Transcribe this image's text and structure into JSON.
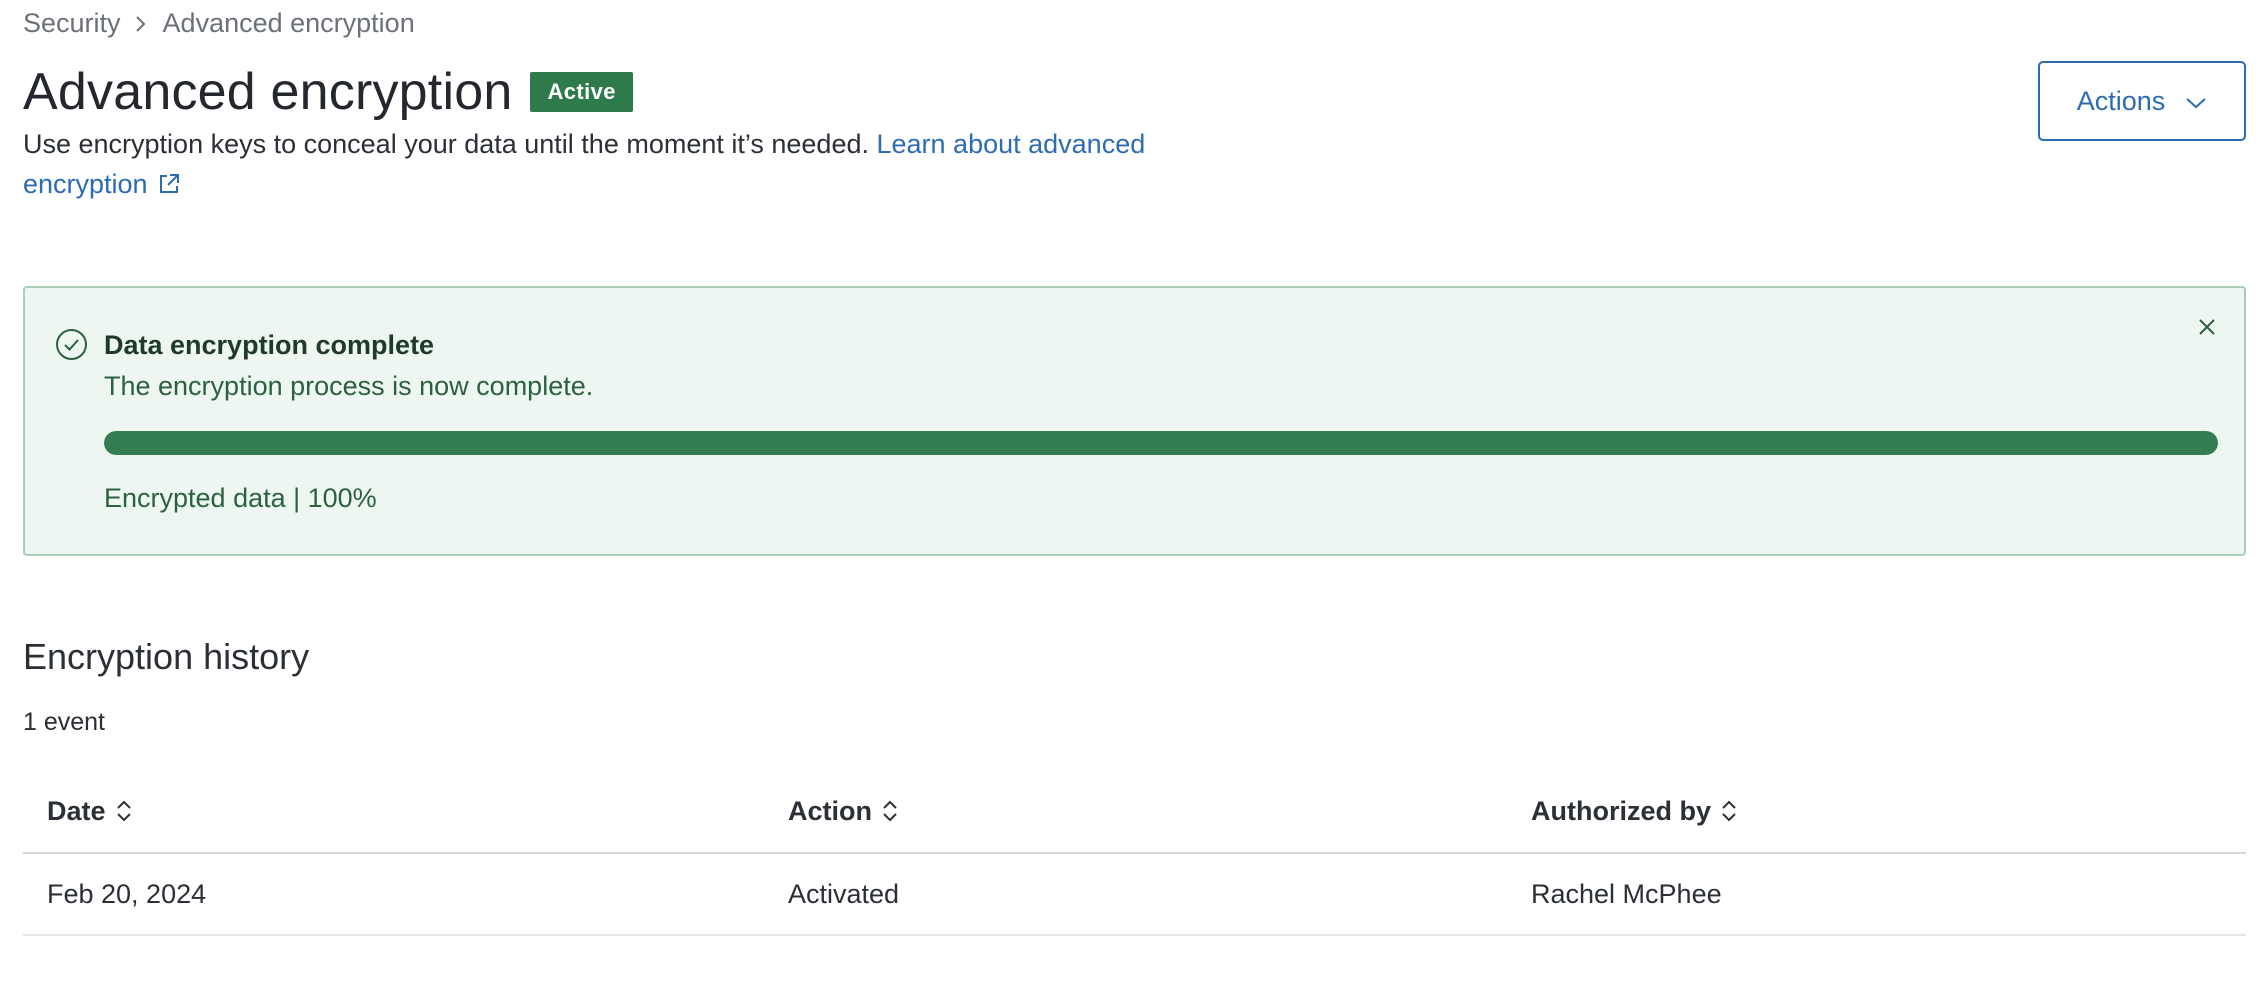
{
  "breadcrumb": {
    "items": [
      "Security",
      "Advanced encryption"
    ]
  },
  "header": {
    "title": "Advanced encryption",
    "status_badge": "Active",
    "description": "Use encryption keys to conceal your data until the moment it’s needed.",
    "learn_link_text": "Learn about advanced encryption",
    "actions_label": "Actions"
  },
  "alert": {
    "title": "Data encryption complete",
    "message": "The encryption process is now complete.",
    "progress_label": "Encrypted data | 100%",
    "progress_percent": 100,
    "icon": "check-circle-icon"
  },
  "history": {
    "title": "Encryption history",
    "count_label": "1 event",
    "columns": [
      "Date",
      "Action",
      "Authorized by"
    ],
    "rows": [
      {
        "date": "Feb 20, 2024",
        "action": "Activated",
        "authorized_by": "Rachel McPhee"
      }
    ]
  },
  "colors": {
    "accent": "#2d6cb3",
    "success": "#2f7a4b",
    "alert_background": "#eef6f2",
    "alert_border": "#a7cfb7"
  }
}
